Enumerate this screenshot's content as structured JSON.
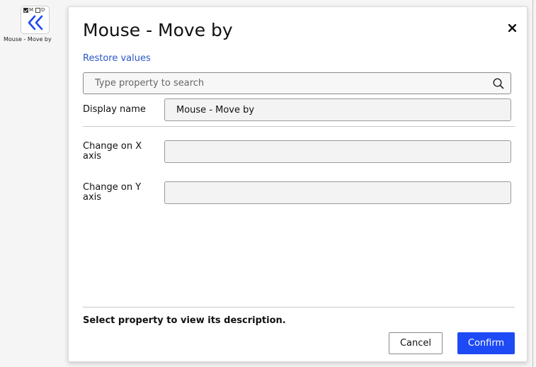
{
  "node": {
    "flag_m": "M",
    "flag_d": "D",
    "label": "Mouse - Move by",
    "icon": "double-chevron-left-icon",
    "icon_color": "#1d4af5"
  },
  "dialog": {
    "title": "Mouse - Move by",
    "close_icon": "close-icon",
    "restore_label": "Restore values",
    "search": {
      "placeholder": "Type property to search",
      "value": ""
    },
    "properties": [
      {
        "label": "Display name",
        "value": "Mouse - Move by"
      },
      {
        "label": "Change on X axis",
        "value": ""
      },
      {
        "label": "Change on Y axis",
        "value": ""
      }
    ],
    "description": "Select property to view its description.",
    "cancel_label": "Cancel",
    "confirm_label": "Confirm",
    "accent_color": "#1d4af5",
    "link_color": "#2b56c6"
  }
}
